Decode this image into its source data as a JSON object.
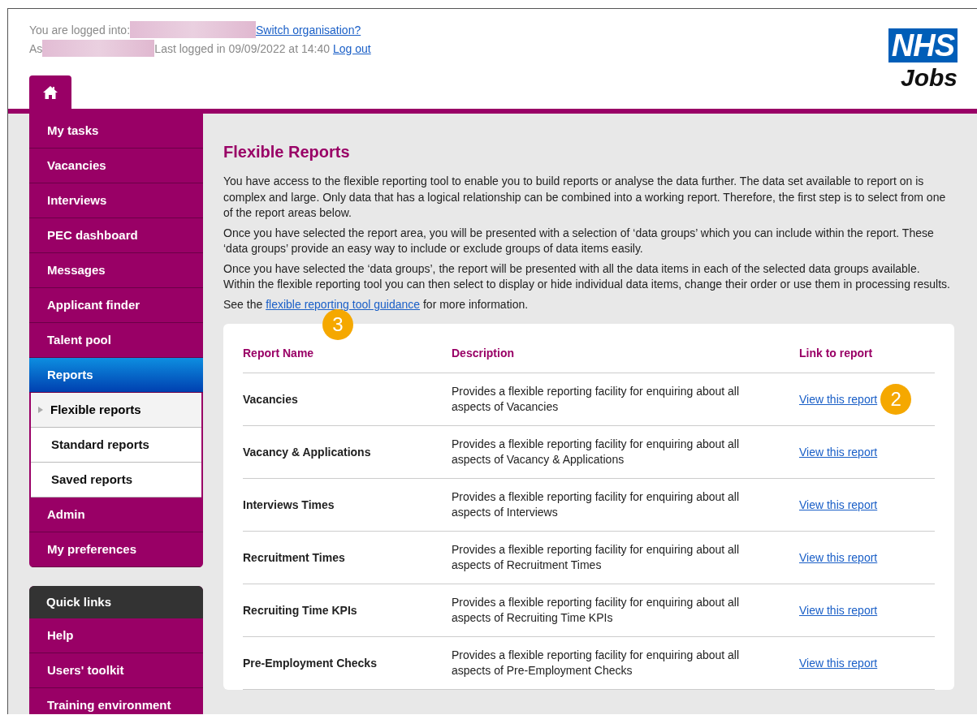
{
  "header": {
    "logged_into_label": "You are logged into:",
    "switch_link": "Switch organisation?",
    "as_label": "As",
    "last_logged": "Last logged in 09/09/2022 at 14:40",
    "logout_link": "Log out",
    "logo": {
      "mark": "NHS",
      "sub": "Jobs"
    }
  },
  "nav": {
    "items": [
      {
        "label": "My tasks",
        "selected": false
      },
      {
        "label": "Vacancies",
        "selected": false
      },
      {
        "label": "Interviews",
        "selected": false
      },
      {
        "label": "PEC dashboard",
        "selected": false
      },
      {
        "label": "Messages",
        "selected": false
      },
      {
        "label": "Applicant finder",
        "selected": false
      },
      {
        "label": "Talent pool",
        "selected": false
      },
      {
        "label": "Reports",
        "selected": true,
        "children": [
          {
            "label": "Flexible reports",
            "selected": true
          },
          {
            "label": "Standard reports",
            "selected": false
          },
          {
            "label": "Saved reports",
            "selected": false
          }
        ]
      },
      {
        "label": "Admin",
        "selected": false
      },
      {
        "label": "My preferences",
        "selected": false
      }
    ]
  },
  "quick_links": {
    "title": "Quick links",
    "items": [
      "Help",
      "Users' toolkit",
      "Training environment"
    ]
  },
  "main": {
    "title": "Flexible Reports",
    "paragraphs": [
      "You have access to the flexible reporting tool to enable you to build reports or analyse the data further. The data set available to report on is complex and large. Only data that has a logical relationship can be combined into a working report. Therefore, the first step is to select from one of the report areas below.",
      "Once you have selected the report area, you will be presented with a selection of ‘data groups’ which you can include within the report. These ‘data groups’ provide an easy way to include or exclude groups of data items easily.",
      "Once you have selected the ‘data groups’, the report will be presented with all the data items in each of the selected data groups available. Within the flexible reporting tool you can then select to display or hide individual data items, change their order or use them in processing results."
    ],
    "guidance": {
      "before": "See the",
      "link": "flexible reporting tool guidance",
      "after": "for more information."
    },
    "callout_guidance": "3",
    "table": {
      "columns": [
        "Report Name",
        "Description",
        "Link to report"
      ],
      "rows": [
        {
          "name": "Vacancies",
          "description": "Provides a flexible reporting facility for enquiring about all aspects of Vacancies",
          "link": "View this report",
          "callout": "2"
        },
        {
          "name": "Vacancy & Applications",
          "description": "Provides a flexible reporting facility for enquiring about all aspects of Vacancy & Applications",
          "link": "View this report"
        },
        {
          "name": "Interviews Times",
          "description": "Provides a flexible reporting facility for enquiring about all aspects of Interviews",
          "link": "View this report"
        },
        {
          "name": "Recruitment Times",
          "description": "Provides a flexible reporting facility for enquiring about all aspects of Recruitment Times",
          "link": "View this report"
        },
        {
          "name": "Recruiting Time KPIs",
          "description": "Provides a flexible reporting facility for enquiring about all aspects of Recruiting Time KPIs",
          "link": "View this report"
        },
        {
          "name": "Pre-Employment Checks",
          "description": "Provides a flexible reporting facility for enquiring about all aspects of Pre-Employment Checks",
          "link": "View this report"
        }
      ]
    }
  }
}
